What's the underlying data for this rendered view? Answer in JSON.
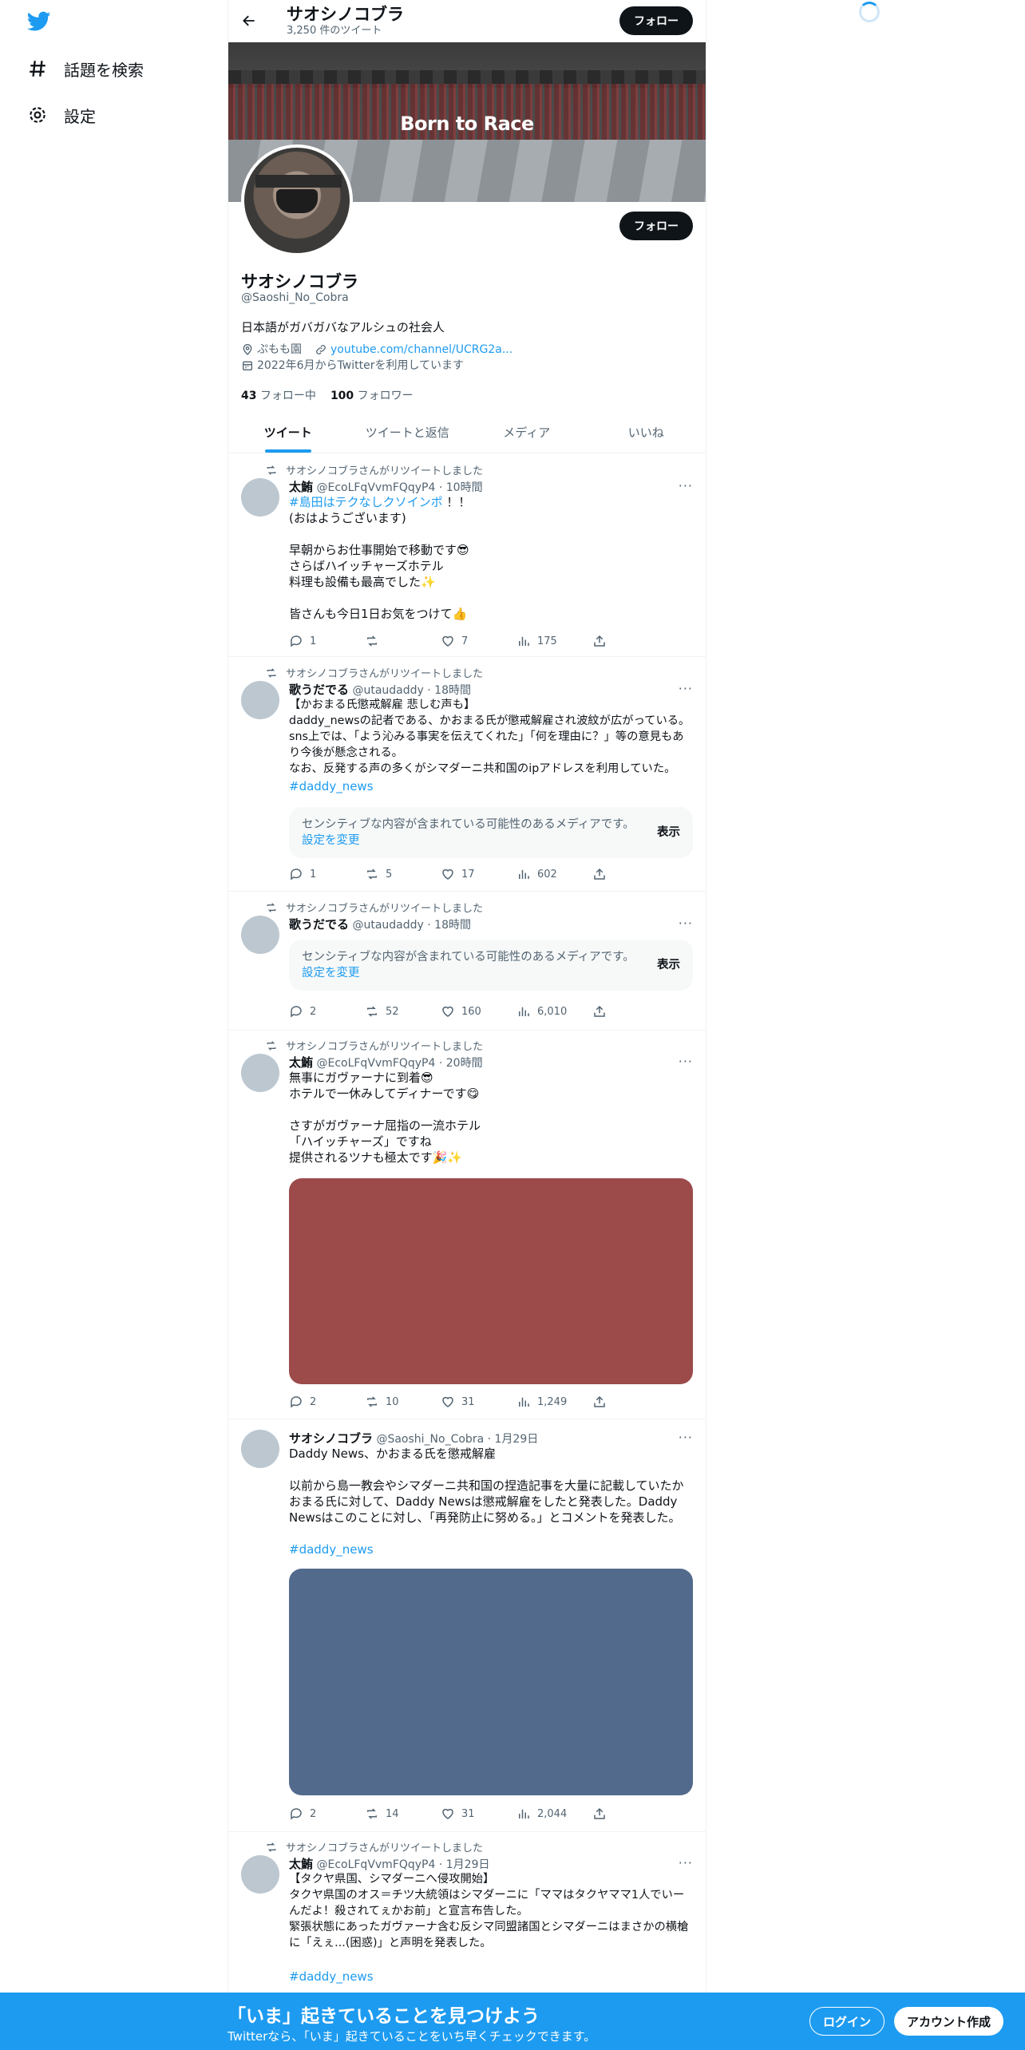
{
  "nav": {
    "explore_label": "話題を検索",
    "settings_label": "設定"
  },
  "header": {
    "name": "サオシノコブラ",
    "tweet_count": "3,250 件のツイート",
    "follow_label": "フォロー"
  },
  "banner": {
    "text": "Born to Race"
  },
  "profile": {
    "follow_label": "フォロー",
    "name": "サオシノコブラ",
    "handle": "@Saoshi_No_Cobra",
    "bio": "日本語がガバガバなアルシュの社会人",
    "location": "ぷもも園",
    "link": "youtube.com/channel/UCRG2a...",
    "joined": "2022年6月からTwitterを利用しています",
    "following_count": "43",
    "following_label": "フォロー中",
    "followers_count": "100",
    "followers_label": "フォロワー"
  },
  "tabs": [
    "ツイート",
    "ツイートと返信",
    "メディア",
    "いいね"
  ],
  "tweets": [
    {
      "retweet_label": "サオシノコブラさんがリツイートしました",
      "name": "太鮪",
      "handle": "@EcoLFqVvmFQqyP4",
      "time": "· 10時間",
      "tag_line": "#島田はテクなしクソインポ",
      "text_after_tag": " ！！",
      "body": "(おはようございます)\n\n早朝からお仕事開始で移動です😎\nさらばハイッチャーズホテル\n料理も設備も最高でした✨\n\n皆さんも今日1日お気をつけて👍",
      "reply": "1",
      "retweet": "",
      "like": "7",
      "views": "175"
    },
    {
      "retweet_label": "サオシノコブラさんがリツイートしました",
      "name": "歌うだでる",
      "handle": "@utaudaddy",
      "time": "· 18時間",
      "body": "【かおまる氏懲戒解雇 悲しむ声も】\ndaddy_newsの記者である、かおまる氏が懲戒解雇され波紋が広がっている。sns上では、「よう沁みる事実を伝えてくれた」「何を理由に？」等の意見もあり今後が懸念される。\nなお、反発する声の多くがシマダーニ共和国のipアドレスを利用していた。",
      "hashtag": "#daddy_news",
      "sensitive_text": "センシティブな内容が含まれている可能性のあるメディアです。",
      "sensitive_link": "設定を変更",
      "show_label": "表示",
      "reply": "1",
      "retweet": "5",
      "like": "17",
      "views": "602"
    },
    {
      "retweet_label": "サオシノコブラさんがリツイートしました",
      "name": "歌うだでる",
      "handle": "@utaudaddy",
      "time": "· 18時間",
      "sensitive_text": "センシティブな内容が含まれている可能性のあるメディアです。",
      "sensitive_link": "設定を変更",
      "show_label": "表示",
      "reply": "2",
      "retweet": "52",
      "like": "160",
      "views": "6,010"
    },
    {
      "retweet_label": "サオシノコブラさんがリツイートしました",
      "name": "太鮪",
      "handle": "@EcoLFqVvmFQqyP4",
      "time": "· 20時間",
      "body": "無事にガヴァーナに到着😎\nホテルで一休みしてディナーです😋\n\nさすがガヴァーナ屈指の一流ホテル\n「ハイッチャーズ」ですね\n提供されるツナも極太です🎉✨",
      "media_color": "#9c4a4a",
      "reply": "2",
      "retweet": "10",
      "like": "31",
      "views": "1,249"
    },
    {
      "name": "サオシノコブラ",
      "handle": "@Saoshi_No_Cobra",
      "time": "· 1月29日",
      "body": "Daddy News、かおまる氏を懲戒解雇\n\n以前から島一教会やシマダーニ共和国の捏造記事を大量に記載していたかおまる氏に対して、Daddy Newsは懲戒解雇をしたと発表した。Daddy Newsはこのことに対し、「再発防止に努める。」とコメントを発表した。",
      "hashtag": "#daddy_news",
      "media_color": "#526a8c",
      "reply": "2",
      "retweet": "14",
      "like": "31",
      "views": "2,044"
    },
    {
      "retweet_label": "サオシノコブラさんがリツイートしました",
      "name": "太鮪",
      "handle": "@EcoLFqVvmFQqyP4",
      "time": "· 1月29日",
      "body": "【タクヤ県国、シマダーニへ侵攻開始】\nタクヤ県国のオス＝チツ大統領はシマダーニに「ママはタクヤママ1人でいーんだよ！殺されてぇかお前」と宣言布告した。\n緊張状態にあったガヴァーナ含む反シマ同盟諸国とシマダーニはまさかの横槍に「えぇ...(困惑)」と声明を発表した。",
      "hashtag": "#daddy_news"
    }
  ],
  "bottom": {
    "title": "「いま」起きていることを見つけよう",
    "subtitle": "Twitterなら、「いま」起きていることをいち早くチェックできます。",
    "login_label": "ログイン",
    "signup_label": "アカウント作成"
  },
  "colors": {
    "accent": "#1d9bf0",
    "text": "#0f1419",
    "muted": "#536471"
  }
}
